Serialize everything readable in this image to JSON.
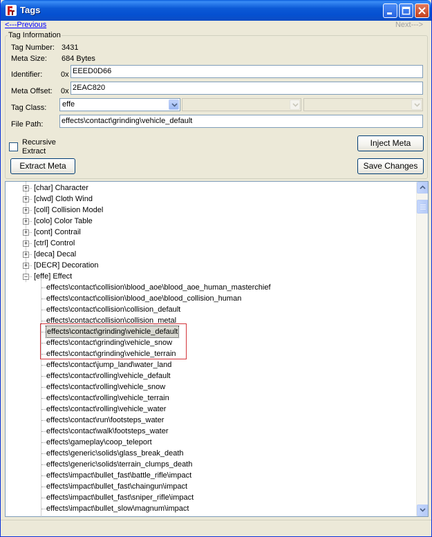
{
  "window": {
    "title": "Tags"
  },
  "nav": {
    "previous": "<---Previous",
    "next": "Next--->"
  },
  "tag_info": {
    "legend": "Tag Information",
    "tag_number_label": "Tag Number:",
    "tag_number_value": "3431",
    "meta_size_label": "Meta Size:",
    "meta_size_value": "684 Bytes",
    "identifier_label": "Identifier:",
    "identifier_prefix": "0x",
    "identifier_value": "EEED0D66",
    "meta_offset_label": "Meta Offset:",
    "meta_offset_prefix": "0x",
    "meta_offset_value": "2EAC820",
    "tag_class_label": "Tag Class:",
    "tag_class_value": "effe",
    "file_path_label": "File Path:",
    "file_path_value": "effects\\contact\\grinding\\vehicle_default",
    "recursive_label_1": "Recursive",
    "recursive_label_2": "Extract"
  },
  "buttons": {
    "inject_meta": "Inject Meta",
    "extract_meta": "Extract Meta",
    "save_changes": "Save Changes"
  },
  "tree": {
    "categories": [
      "[char] Character",
      "[clwd] Cloth Wind",
      "[coll] Collision Model",
      "[colo] Color Table",
      "[cont] Contrail",
      "[ctrl] Control",
      "[deca] Decal",
      "[DECR] Decoration",
      "[effe] Effect"
    ],
    "effect_items": [
      "effects\\contact\\collision\\blood_aoe\\blood_aoe_human_masterchief",
      "effects\\contact\\collision\\blood_aoe\\blood_collision_human",
      "effects\\contact\\collision\\collision_default",
      "effects\\contact\\collision\\collision_metal",
      "effects\\contact\\grinding\\vehicle_default",
      "effects\\contact\\grinding\\vehicle_snow",
      "effects\\contact\\grinding\\vehicle_terrain",
      "effects\\contact\\jump_land\\water_land",
      "effects\\contact\\rolling\\vehicle_default",
      "effects\\contact\\rolling\\vehicle_snow",
      "effects\\contact\\rolling\\vehicle_terrain",
      "effects\\contact\\rolling\\vehicle_water",
      "effects\\contact\\run\\footsteps_water",
      "effects\\contact\\walk\\footsteps_water",
      "effects\\gameplay\\coop_teleport",
      "effects\\generic\\solids\\glass_break_death",
      "effects\\generic\\solids\\terrain_clumps_death",
      "effects\\impact\\bullet_fast\\battle_rifle\\impact",
      "effects\\impact\\bullet_fast\\chaingun\\impact",
      "effects\\impact\\bullet_fast\\sniper_rifle\\impact",
      "effects\\impact\\bullet_slow\\magnum\\impact"
    ],
    "expand_collapsed": "+",
    "expand_open": "−"
  },
  "colors": {
    "title_bar": "#0a5fdd",
    "highlight_box": "#d3343a",
    "link": "#0000ff"
  }
}
